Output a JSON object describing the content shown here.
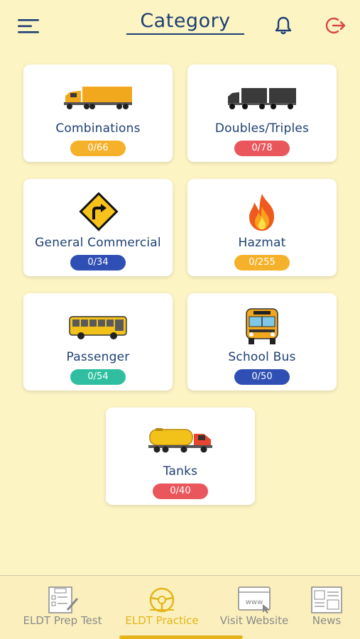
{
  "header": {
    "title": "Category",
    "menu_icon": "hamburger-menu-icon",
    "notification_icon": "bell-icon",
    "logout_icon": "logout-icon"
  },
  "categories": [
    {
      "label": "Combinations",
      "progress": "0/66",
      "badge_color": "#f5b129",
      "icon": "semi-truck-icon"
    },
    {
      "label": "Doubles/Triples",
      "progress": "0/78",
      "badge_color": "#e9575d",
      "icon": "double-trailer-truck-icon"
    },
    {
      "label": "General Commercial",
      "progress": "0/34",
      "badge_color": "#2f4fb4",
      "icon": "road-sign-icon"
    },
    {
      "label": "Hazmat",
      "progress": "0/255",
      "badge_color": "#f5b129",
      "icon": "fire-icon"
    },
    {
      "label": "Passenger",
      "progress": "0/54",
      "badge_color": "#2fbfa0",
      "icon": "bus-icon"
    },
    {
      "label": "School Bus",
      "progress": "0/50",
      "badge_color": "#2f4fb4",
      "icon": "school-bus-icon"
    },
    {
      "label": "Tanks",
      "progress": "0/40",
      "badge_color": "#e9575d",
      "icon": "tanker-truck-icon"
    }
  ],
  "bottom_nav": [
    {
      "label": "ELDT Prep Test",
      "icon": "test-sheet-icon",
      "active": false
    },
    {
      "label": "ELDT Practice",
      "icon": "steering-wheel-icon",
      "active": true
    },
    {
      "label": "Visit Website",
      "icon": "website-icon",
      "active": false
    },
    {
      "label": "News",
      "icon": "news-icon",
      "active": false
    }
  ],
  "colors": {
    "background": "#fdf4c4",
    "primary_text": "#1d3f73",
    "active_nav": "#e5b41b",
    "inactive_nav": "#8a8a8a"
  }
}
